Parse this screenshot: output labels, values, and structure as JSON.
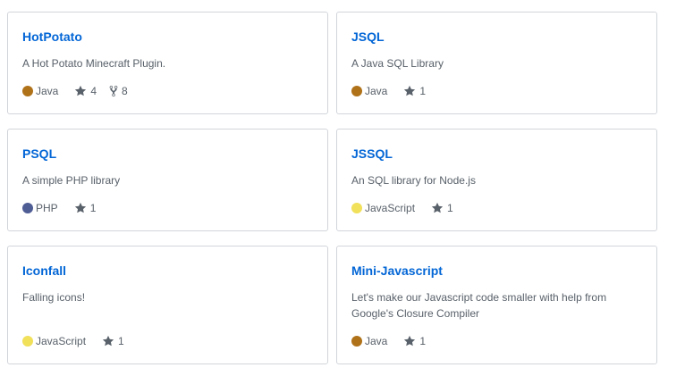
{
  "repos": [
    {
      "name": "HotPotato",
      "description": "A Hot Potato Minecraft Plugin.",
      "language": "Java",
      "language_color": "#b07219",
      "stars": "4",
      "forks": "8"
    },
    {
      "name": "JSQL",
      "description": "A Java SQL Library",
      "language": "Java",
      "language_color": "#b07219",
      "stars": "1"
    },
    {
      "name": "PSQL",
      "description": "A simple PHP library",
      "language": "PHP",
      "language_color": "#4F5D95",
      "stars": "1"
    },
    {
      "name": "JSSQL",
      "description": "An SQL library for Node.js",
      "language": "JavaScript",
      "language_color": "#f1e05a",
      "stars": "1"
    },
    {
      "name": "Iconfall",
      "description": "Falling icons!",
      "language": "JavaScript",
      "language_color": "#f1e05a",
      "stars": "1"
    },
    {
      "name": "Mini-Javascript",
      "description": "Let's make our Javascript code smaller with help from Google's Closure Compiler",
      "language": "Java",
      "language_color": "#b07219",
      "stars": "1"
    }
  ],
  "icons": {
    "star": "star-icon",
    "fork": "fork-icon"
  },
  "colors": {
    "link": "#0366d6",
    "muted": "#586069",
    "border": "#d1d5da"
  }
}
